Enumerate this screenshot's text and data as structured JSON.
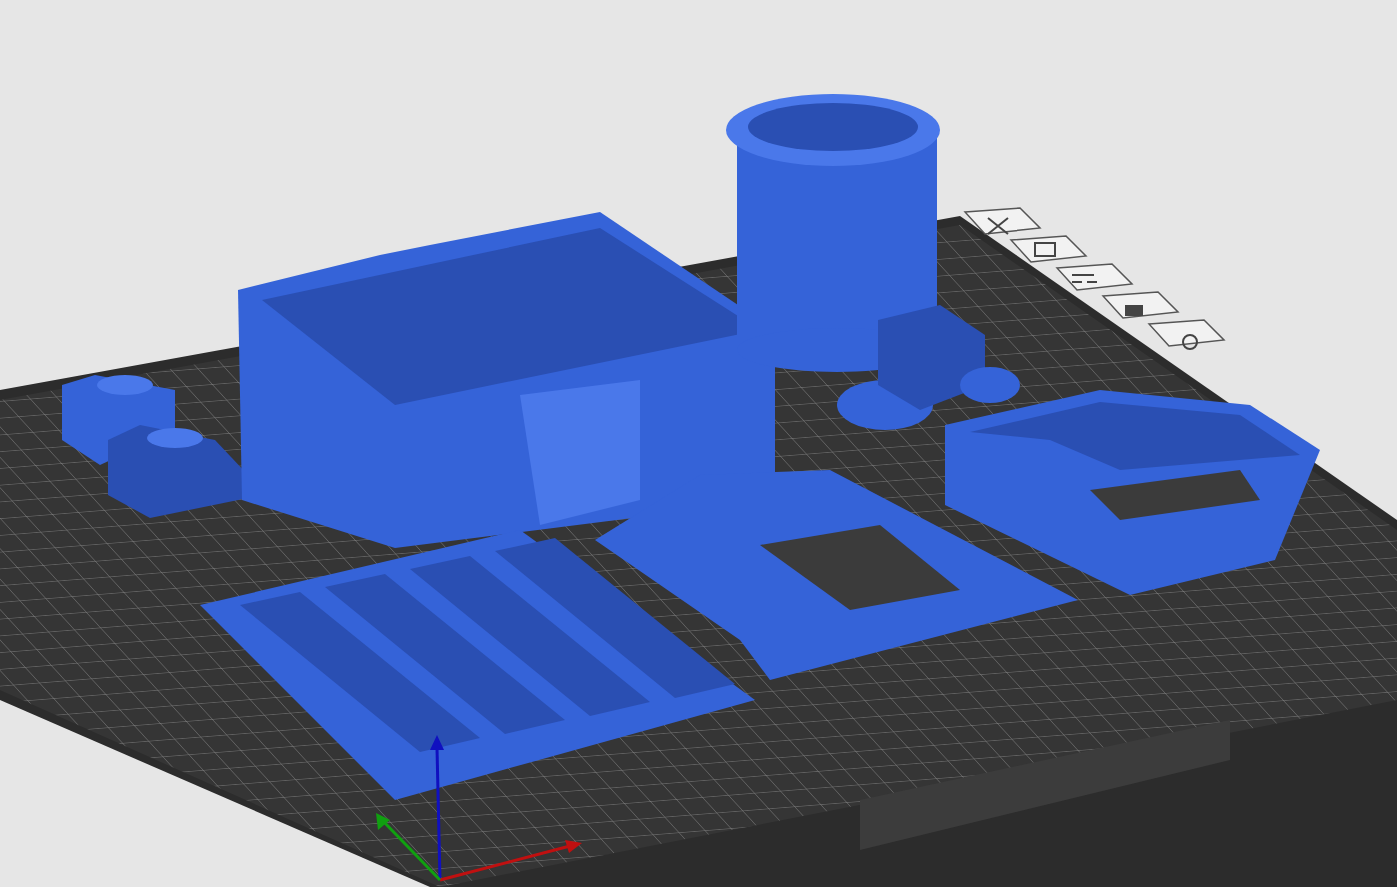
{
  "viewport": {
    "bed_icons": [
      {
        "kind": "cross"
      },
      {
        "kind": "monitor"
      },
      {
        "kind": "layout"
      },
      {
        "kind": "lock"
      },
      {
        "kind": "gear"
      }
    ],
    "objects": [
      {
        "kind": "brackets"
      },
      {
        "kind": "enclosure"
      },
      {
        "kind": "cup"
      },
      {
        "kind": "stand"
      },
      {
        "kind": "ring"
      },
      {
        "kind": "tray"
      },
      {
        "kind": "plate"
      }
    ],
    "axes": [
      {
        "kind": "z"
      },
      {
        "kind": "x"
      },
      {
        "kind": "y"
      }
    ]
  }
}
